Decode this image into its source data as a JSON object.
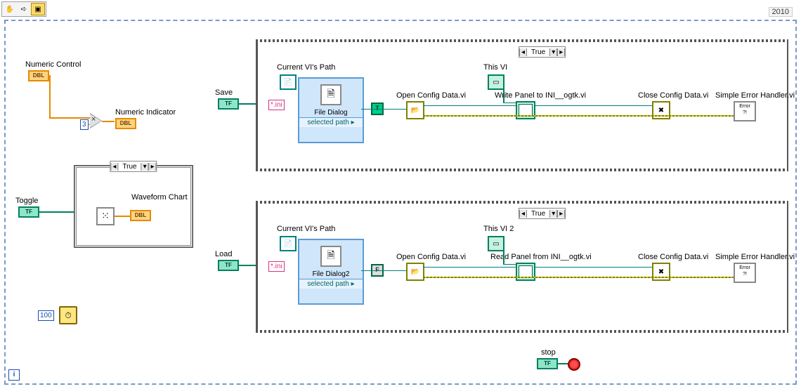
{
  "year": "2010",
  "labels": {
    "numeric_control": "Numeric Control",
    "numeric_indicator": "Numeric Indicator",
    "toggle": "Toggle",
    "waveform_chart": "Waveform Chart",
    "save": "Save",
    "load": "Load",
    "current_vi_path_1": "Current VI's Path",
    "current_vi_path_2": "Current VI's Path",
    "this_vi_1": "This VI",
    "this_vi_2": "This VI 2",
    "open_config_1": "Open Config Data.vi",
    "open_config_2": "Open Config Data.vi",
    "write_panel": "Write Panel to INI__ogtk.vi",
    "read_panel": "Read Panel from INI__ogtk.vi",
    "close_config_1": "Close Config Data.vi",
    "close_config_2": "Close Config Data.vi",
    "error_handler_1": "Simple Error Handler.vi",
    "error_handler_2": "Simple Error Handler.vi",
    "stop": "stop",
    "file_dialog_1_title": "File Dialog",
    "file_dialog_2_title": "File Dialog2",
    "selected_path": "selected path"
  },
  "constants": {
    "multiply_input": "3",
    "wait_ms": "100",
    "ini_ext_1": "*.ini",
    "ini_ext_2": "*.ini",
    "bool_true_1": "T",
    "bool_false_1": "F"
  },
  "terminals": {
    "dbl": "DBL",
    "tf": "TF"
  },
  "case_values": {
    "toggle_case": "True",
    "save_case": "True",
    "load_case": "True"
  }
}
